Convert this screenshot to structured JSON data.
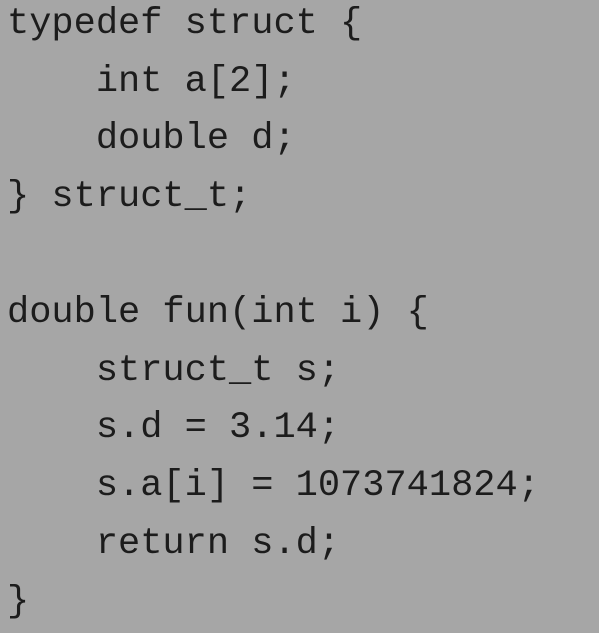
{
  "code": {
    "lines": [
      "typedef struct {",
      "    int a[2];",
      "    double d;",
      "} struct_t;",
      "",
      "double fun(int i) {",
      "    struct_t s;",
      "    s.d = 3.14;",
      "    s.a[i] = 1073741824;",
      "    return s.d;",
      "}"
    ]
  }
}
